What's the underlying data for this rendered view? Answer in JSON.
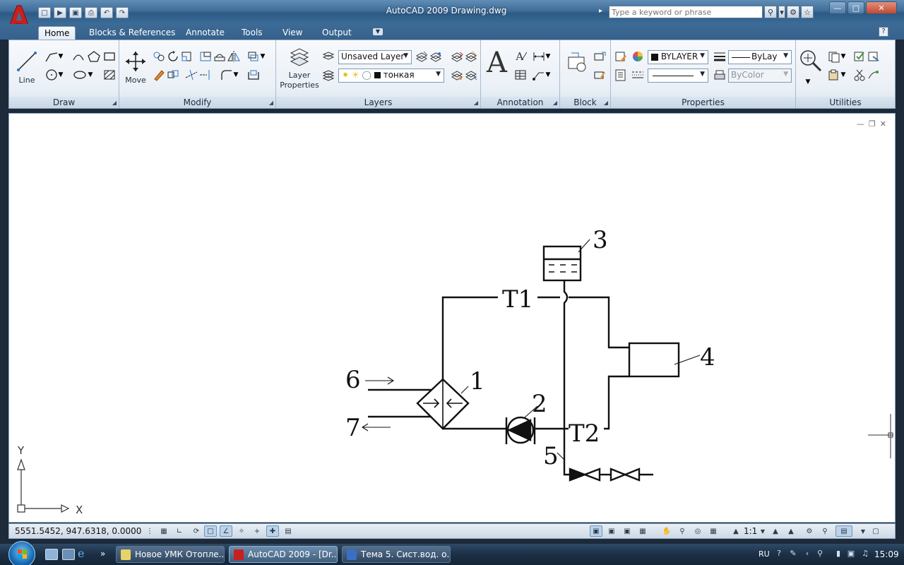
{
  "window": {
    "title": "AutoCAD 2009 Drawing.dwg",
    "search_placeholder": "Type a keyword or phrase"
  },
  "tabs": [
    "Home",
    "Blocks & References",
    "Annotate",
    "Tools",
    "View",
    "Output"
  ],
  "active_tab": "Home",
  "ribbon": {
    "panels": {
      "draw": "Draw",
      "modify": "Modify",
      "layers": "Layers",
      "annotation": "Annotation",
      "block": "Block",
      "properties": "Properties",
      "utilities": "Utilities"
    },
    "line_label": "Line",
    "move_label": "Move",
    "layer_properties_label": "Layer Properties",
    "layer_combo": "Unsaved Layer",
    "current_layer": "тонкая",
    "color_combo": "BYLAYER",
    "linetype_combo": "ByLay",
    "plotstyle_combo": "ByColor"
  },
  "drawing": {
    "labels": [
      "1",
      "2",
      "3",
      "4",
      "5",
      "6",
      "7"
    ],
    "pipe_t1": "T1",
    "pipe_t2": "T2",
    "ucs_y": "Y",
    "ucs_x": "X"
  },
  "status": {
    "coordinates": "5551.5452, 947.6318, 0.0000",
    "annotation_scale": "1:1"
  },
  "taskbar": {
    "tasks": [
      "Новое УМК Отопле...",
      "AutoCAD 2009 - [Dr...",
      "Тема 5. Сист.вод. о..."
    ],
    "active_task": 1,
    "language": "RU",
    "clock": "15:09"
  },
  "colors": {
    "title_bar": "#3f6d98",
    "ribbon_bg": "#eaf0f6",
    "autocad_red": "#c8201f",
    "taskbar": "#1b2f45"
  }
}
